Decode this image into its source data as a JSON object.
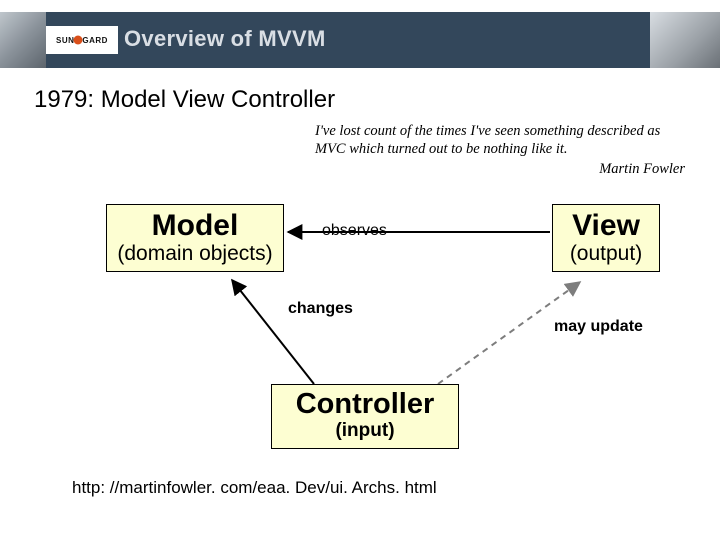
{
  "logo": "SUNGARD",
  "header_title": "Overview of MVVM",
  "section_title": "1979: Model View Controller",
  "quote_body": "I've lost count of the times I've seen something described as MVC which turned out to be nothing like it.",
  "quote_attr": "Martin Fowler",
  "boxes": {
    "model": {
      "title": "Model",
      "sub": "(domain objects)"
    },
    "view": {
      "title": "View",
      "sub": "(output)"
    },
    "controller": {
      "title": "Controller",
      "sub": "(input)"
    }
  },
  "edges": {
    "observes": "observes",
    "changes": "changes",
    "may_update": "may update"
  },
  "footer_url": "http: //martinfowler. com/eaa. Dev/ui. Archs. html"
}
